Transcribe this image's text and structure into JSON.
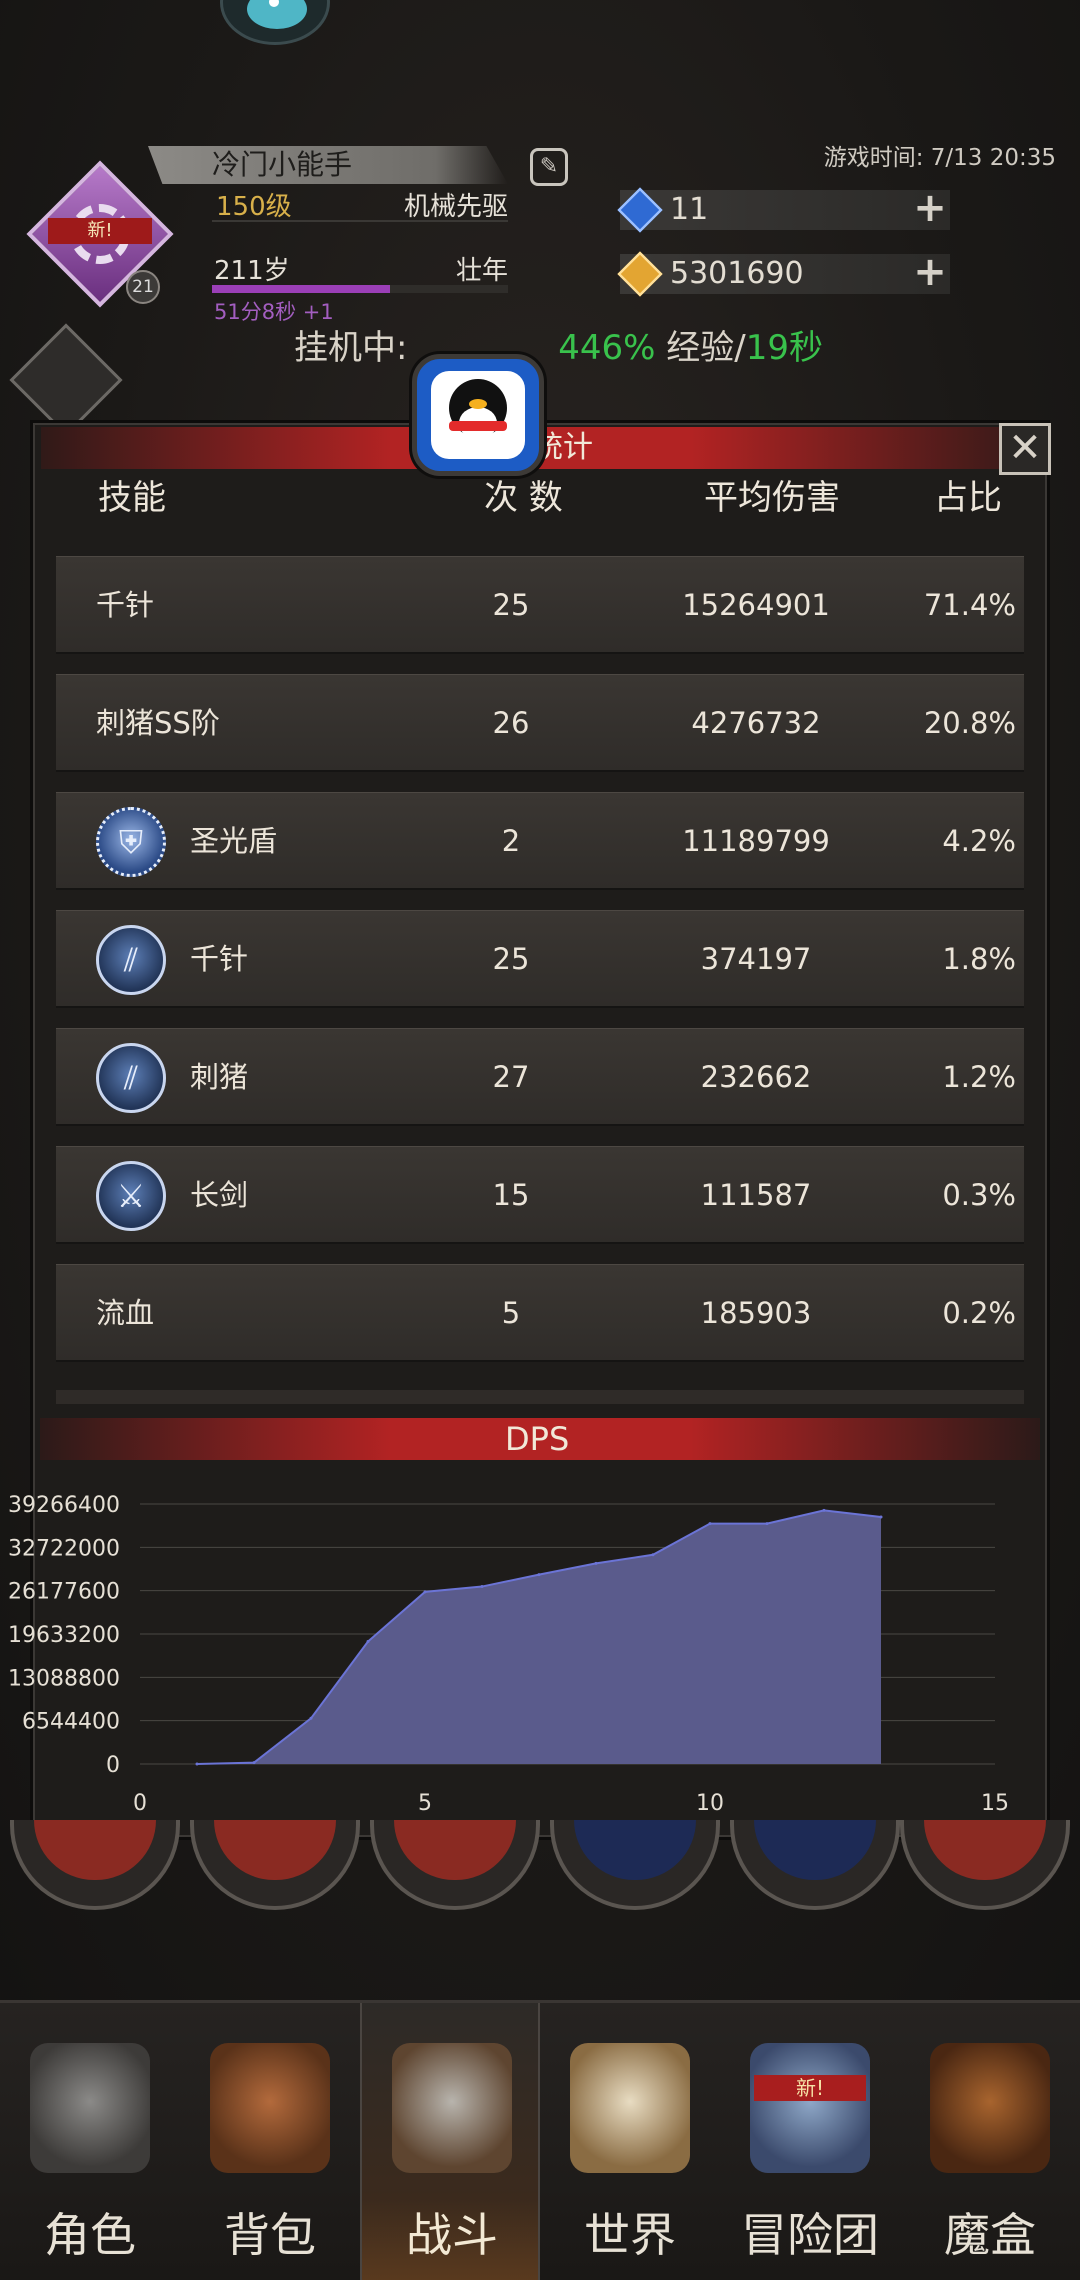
{
  "player": {
    "name": "冷门小能手",
    "level": "150级",
    "class": "机械先驱",
    "age": "211岁",
    "stage": "壮年",
    "age_timer": "51分8秒 +1",
    "badge_new": "新!",
    "badge_level": "21",
    "age_progress": 0.6
  },
  "header": {
    "game_time": "游戏时间: 7/13 20:35",
    "diamonds": "11",
    "gold": "5301690",
    "idle_prefix": "挂机中:",
    "idle_pct": "446%",
    "idle_exp": "经验/",
    "idle_time": "19秒"
  },
  "modal": {
    "title": "统计",
    "columns": [
      "技能",
      "次 数",
      "平均伤害",
      "占比"
    ],
    "rows": [
      {
        "name": "千针",
        "count": "25",
        "avg": "15264901",
        "pct": "71.4%",
        "icon": ""
      },
      {
        "name": "刺猪SS阶",
        "count": "26",
        "avg": "4276732",
        "pct": "20.8%",
        "icon": ""
      },
      {
        "name": "圣光盾",
        "count": "2",
        "avg": "11189799",
        "pct": "4.2%",
        "icon": "shield-skill-icon"
      },
      {
        "name": "千针",
        "count": "25",
        "avg": "374197",
        "pct": "1.8%",
        "icon": "claw-skill-icon"
      },
      {
        "name": "刺猪",
        "count": "27",
        "avg": "232662",
        "pct": "1.2%",
        "icon": "claw-skill-icon"
      },
      {
        "name": "长剑",
        "count": "15",
        "avg": "111587",
        "pct": "0.3%",
        "icon": "sword-skill-icon"
      },
      {
        "name": "流血",
        "count": "5",
        "avg": "185903",
        "pct": "0.2%",
        "icon": ""
      }
    ]
  },
  "chart_data": {
    "type": "area",
    "title": "DPS",
    "xlabel": "",
    "ylabel": "",
    "x": [
      1,
      2,
      3,
      4,
      5,
      6,
      7,
      8,
      9,
      10,
      11,
      12,
      13
    ],
    "y": [
      0,
      200000,
      6900000,
      18500000,
      26000000,
      26800000,
      28600000,
      30300000,
      31600000,
      36300000,
      36300000,
      38300000,
      37300000
    ],
    "xlim": [
      0,
      15
    ],
    "ylim": [
      0,
      39266400
    ],
    "xticks": [
      "0",
      "5",
      "10",
      "15"
    ],
    "yticks": [
      "0",
      "6544400",
      "13088800",
      "19633200",
      "26177600",
      "32722000",
      "39266400"
    ],
    "grid": true,
    "colors": {
      "fill": "#5a5b8c",
      "line": "#6b74d6"
    }
  },
  "nav": {
    "items": [
      {
        "label": "角色"
      },
      {
        "label": "背包"
      },
      {
        "label": "战斗"
      },
      {
        "label": "世界"
      },
      {
        "label": "冒险团"
      },
      {
        "label": "魔盒"
      }
    ],
    "active_index": 2,
    "new_flag": "新!"
  }
}
